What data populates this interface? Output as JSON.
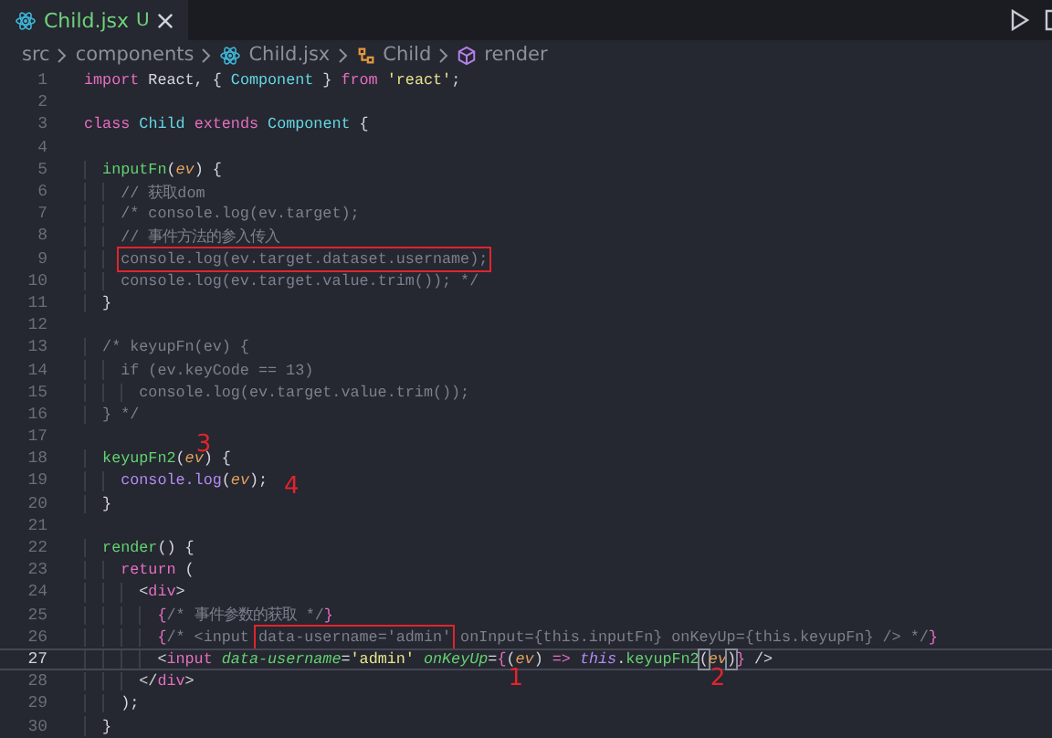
{
  "tab": {
    "label": "Child.jsx",
    "badge": "U",
    "selected": true
  },
  "breadcrumb": [
    {
      "text": "src",
      "kind": "folder"
    },
    {
      "text": "components",
      "kind": "folder"
    },
    {
      "text": "Child.jsx",
      "kind": "react"
    },
    {
      "text": "Child",
      "kind": "class"
    },
    {
      "text": "render",
      "kind": "method"
    }
  ],
  "lines": [
    {
      "number": "1",
      "tokens": [
        {
          "text": "import",
          "kind": "kw"
        },
        {
          "text": " React, { ",
          "kind": "plain"
        },
        {
          "text": "Component",
          "kind": "cls"
        },
        {
          "text": " } ",
          "kind": "plain"
        },
        {
          "text": "from",
          "kind": "kw"
        },
        {
          "text": " 'react'",
          "kind": "str"
        },
        {
          "text": ";",
          "kind": "plain"
        }
      ]
    },
    {
      "number": "2"
    },
    {
      "number": "3",
      "tokens": [
        {
          "text": "class",
          "kind": "kw"
        },
        {
          "text": " Child",
          "kind": "cls"
        },
        {
          "text": " extends",
          "kind": "kw"
        },
        {
          "text": " Component",
          "kind": "cls"
        },
        {
          "text": " {",
          "kind": "plain"
        }
      ]
    },
    {
      "number": "4"
    },
    {
      "number": "5",
      "tokens": [
        {
          "text": "  inputFn",
          "kind": "fn"
        },
        {
          "text": "(",
          "kind": "plain"
        },
        {
          "text": "ev",
          "kind": "param"
        },
        {
          "text": ") {",
          "kind": "plain"
        }
      ]
    },
    {
      "number": "6",
      "tokens": [
        {
          "text": "    // 获取dom",
          "kind": "cmt"
        }
      ]
    },
    {
      "number": "7",
      "tokens": [
        {
          "text": "    /* console.log(ev.target);",
          "kind": "cmt"
        }
      ]
    },
    {
      "number": "8",
      "tokens": [
        {
          "text": "    // 事件方法的参入传入",
          "kind": "cmt"
        }
      ]
    },
    {
      "number": "9",
      "tokens": [
        {
          "text": "    console.log(ev.target.dataset.username);",
          "kind": "cmt",
          "boxed": true
        }
      ]
    },
    {
      "number": "10",
      "tokens": [
        {
          "text": "    console.log(ev.target.value.trim()); */",
          "kind": "cmt"
        }
      ]
    },
    {
      "number": "11",
      "tokens": [
        {
          "text": "  }",
          "kind": "plain"
        }
      ]
    },
    {
      "number": "12"
    },
    {
      "number": "13",
      "tokens": [
        {
          "text": "  /* keyupFn(ev) {",
          "kind": "cmt"
        }
      ]
    },
    {
      "number": "14",
      "tokens": [
        {
          "text": "    if (ev.keyCode == 13)",
          "kind": "cmt"
        }
      ]
    },
    {
      "number": "15",
      "tokens": [
        {
          "text": "      console.log(ev.target.value.trim());",
          "kind": "cmt"
        }
      ]
    },
    {
      "number": "16",
      "tokens": [
        {
          "text": "  } */",
          "kind": "cmt"
        }
      ]
    },
    {
      "number": "17"
    },
    {
      "number": "18",
      "tokens": [
        {
          "text": "  keyupFn2",
          "kind": "fn"
        },
        {
          "text": "(",
          "kind": "plain"
        },
        {
          "text": "ev",
          "kind": "param",
          "note_above": "3"
        },
        {
          "text": ") {",
          "kind": "plain"
        }
      ]
    },
    {
      "number": "19",
      "tokens": [
        {
          "text": "    console.log",
          "kind": "var"
        },
        {
          "text": "(",
          "kind": "plain"
        },
        {
          "text": "ev",
          "kind": "param"
        },
        {
          "text": ");",
          "kind": "plain",
          "note_after": "4"
        }
      ]
    },
    {
      "number": "20",
      "tokens": [
        {
          "text": "  }",
          "kind": "plain"
        }
      ]
    },
    {
      "number": "21"
    },
    {
      "number": "22",
      "tokens": [
        {
          "text": "  render",
          "kind": "fn"
        },
        {
          "text": "() {",
          "kind": "plain"
        }
      ]
    },
    {
      "number": "23",
      "tokens": [
        {
          "text": "    return",
          "kind": "kw"
        },
        {
          "text": " (",
          "kind": "plain"
        }
      ]
    },
    {
      "number": "24",
      "tokens": [
        {
          "text": "      <",
          "kind": "punct"
        },
        {
          "text": "div",
          "kind": "tag"
        },
        {
          "text": ">",
          "kind": "punct"
        }
      ]
    },
    {
      "number": "25",
      "tokens": [
        {
          "text": "        {",
          "kind": "brace"
        },
        {
          "text": "/* 事件参数的获取 */",
          "kind": "cmt"
        },
        {
          "text": "}",
          "kind": "brace"
        }
      ]
    },
    {
      "number": "26",
      "tokens": [
        {
          "text": "        {",
          "kind": "brace"
        },
        {
          "text": "/* <input ",
          "kind": "cmt"
        },
        {
          "text": "data-username='admin'",
          "kind": "cmt",
          "boxed": true
        },
        {
          "text": " onInput={this.inputFn} onKeyUp={this.keyupFn} /> */",
          "kind": "cmt"
        },
        {
          "text": "}",
          "kind": "brace"
        }
      ]
    },
    {
      "number": "27",
      "current": true,
      "tokens": [
        {
          "text": "        <",
          "kind": "punct"
        },
        {
          "text": "input",
          "kind": "tag"
        },
        {
          "text": " data-username",
          "kind": "attr"
        },
        {
          "text": "=",
          "kind": "punct"
        },
        {
          "text": "'admin'",
          "kind": "str"
        },
        {
          "text": " onKeyUp",
          "kind": "attr"
        },
        {
          "text": "=",
          "kind": "punct"
        },
        {
          "text": "{",
          "kind": "brace"
        },
        {
          "text": "(",
          "kind": "plain",
          "note_below": "1"
        },
        {
          "text": "ev",
          "kind": "param"
        },
        {
          "text": ") ",
          "kind": "plain"
        },
        {
          "text": "=>",
          "kind": "kw"
        },
        {
          "text": " this",
          "kind": "this"
        },
        {
          "text": ".",
          "kind": "plain"
        },
        {
          "text": "keyupFn2",
          "kind": "fn"
        },
        {
          "text": "(",
          "kind": "plain",
          "matched": true
        },
        {
          "text": "ev",
          "kind": "param",
          "note_below": "2"
        },
        {
          "text": ")",
          "kind": "plain",
          "matched": true
        },
        {
          "text": "}",
          "kind": "brace"
        },
        {
          "text": " />",
          "kind": "punct"
        }
      ]
    },
    {
      "number": "28",
      "tokens": [
        {
          "text": "      </",
          "kind": "punct"
        },
        {
          "text": "div",
          "kind": "tag"
        },
        {
          "text": ">",
          "kind": "punct"
        }
      ]
    },
    {
      "number": "29",
      "tokens": [
        {
          "text": "    );",
          "kind": "plain"
        }
      ]
    },
    {
      "number": "30",
      "tokens": [
        {
          "text": "  }",
          "kind": "plain"
        }
      ]
    }
  ]
}
